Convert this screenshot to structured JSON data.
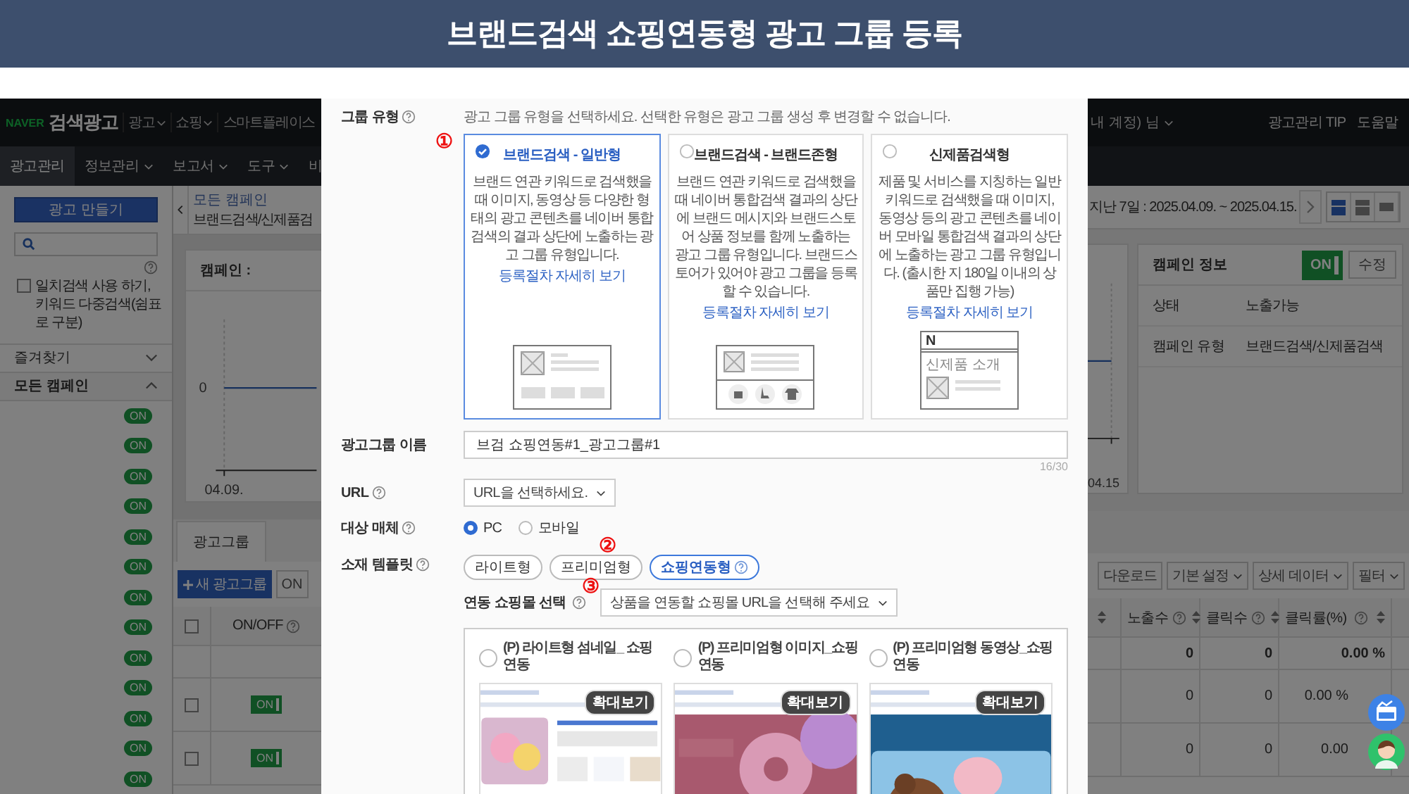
{
  "banner": {
    "title": "브랜드검색 쇼핑연동형 광고 그룹 등록"
  },
  "app": {
    "header": {
      "brand": "NAVER",
      "product": "검색광고",
      "menus": [
        {
          "label": "광고",
          "menu": true
        },
        {
          "label": "쇼핑",
          "menu": true
        },
        {
          "label": "스마트플레이스",
          "menu": false
        }
      ],
      "account": "내 계정) 님",
      "links": [
        "광고관리 TIP",
        "도움말"
      ]
    },
    "nav": [
      {
        "label": "광고관리",
        "selected": true,
        "menu": false
      },
      {
        "label": "정보관리",
        "selected": false,
        "menu": true
      },
      {
        "label": "보고서",
        "selected": false,
        "menu": true
      },
      {
        "label": "도구",
        "selected": false,
        "menu": true
      },
      {
        "label": "비",
        "selected": false,
        "menu": false
      }
    ],
    "sidebar": {
      "create_button": "광고 만들기",
      "exact_match": {
        "lines": [
          "일치검색 사용 하기,",
          "키워드 다중검색(쉼표로 구분)"
        ],
        "checked": false
      },
      "sections": [
        {
          "label": "즐겨찾기",
          "expanded": false
        },
        {
          "label": "모든 캠페인",
          "expanded": true
        }
      ],
      "campaigns": [
        {
          "badge": "ON"
        },
        {
          "badge": "ON"
        },
        {
          "badge": "ON"
        },
        {
          "badge": "ON"
        },
        {
          "badge": "ON"
        },
        {
          "badge": "ON"
        },
        {
          "badge": "ON"
        },
        {
          "badge": "ON"
        },
        {
          "badge": "ON"
        },
        {
          "badge": "ON"
        },
        {
          "badge": "ON"
        },
        {
          "badge": "ON"
        },
        {
          "badge": "ON"
        }
      ]
    },
    "breadcrumb": "모든 캠페인",
    "page_title": "브랜드검색/신제품검",
    "date_range": "지난 7일 : 2025.04.09. ~ 2025.04.15.",
    "views": [
      {
        "selected": true
      },
      {
        "selected": false
      },
      {
        "selected": false
      }
    ],
    "chart": {
      "title": "캠페인 :",
      "y_label": "0",
      "x_labels": [
        "04.09.",
        "04.15"
      ]
    },
    "campaign_info": {
      "title": "캠페인 정보",
      "toggle": {
        "label": "ON",
        "on": true
      },
      "edit": "수정",
      "rows": [
        {
          "key": "상태",
          "value": "노출가능"
        },
        {
          "key": "캠페인 유형",
          "value": "브랜드검색/신제품검색"
        }
      ]
    },
    "tabs": [
      {
        "label": "광고그룹",
        "selected": true
      }
    ],
    "actions": {
      "new_group": "새 광고그룹",
      "on": "ON",
      "tools": [
        {
          "label": "다운로드",
          "menu": false
        },
        {
          "label": "기본 설정",
          "menu": true
        },
        {
          "label": "상세 데이터",
          "menu": true
        },
        {
          "label": "필터",
          "menu": true
        }
      ]
    },
    "table": {
      "columns": [
        "ON/OFF",
        "노출수",
        "클릭수",
        "클릭률(%)"
      ],
      "all_checked": false,
      "summary": [
        "0",
        "0",
        "0.00 %"
      ],
      "rows": [
        {
          "checked": false,
          "toggle": "ON",
          "on": true,
          "cells": [
            "0",
            "0",
            "0.00 %"
          ]
        },
        {
          "checked": false,
          "toggle": "ON",
          "on": true,
          "cells": [
            "0",
            "0",
            "0.00"
          ]
        }
      ]
    }
  },
  "modal": {
    "group_type": {
      "label": "그룹 유형",
      "help": true,
      "hint": "광고 그룹 유형을 선택하세요. 선택한 유형은 광고 그룹 생성 후 변경할 수 없습니다.",
      "marker": "①",
      "options": [
        {
          "title": "브랜드검색 - 일반형",
          "description": "브랜드 연관 키워드로 검색했을 때 이미지, 동영상 등 다양한 형태의 광고 콘텐츠를 네이버 통합검색의 결과 상단에 노출하는 광고 그룹 유형입니다.",
          "link": "등록절차 자세히 보기",
          "selected": true,
          "kind": "general"
        },
        {
          "title": "브랜드검색 - 브랜드존형",
          "description": "브랜드 연관 키워드로 검색했을 때 네이버 통합검색 결과의 상단에 브랜드 메시지와 브랜드스토어 상품 정보를 함께 노출하는 광고 그룹 유형입니다. 브랜드스토어가 있어야 광고 그룹을 등록할 수 있습니다.",
          "link": "등록절차 자세히 보기",
          "selected": false,
          "kind": "store"
        },
        {
          "title": "신제품검색형",
          "description": "제품 및 서비스를 지칭하는 일반 키워드로 검색했을 때 이미지, 동영상 등의 광고 콘텐츠를 네이버 모바일 통합검색 결과의 상단에 노출하는 광고 그룹 유형입니다. (출시한 지 180일 이내의 상품만 집행 가능)",
          "link": "등록절차 자세히 보기",
          "selected": false,
          "kind": "new_product",
          "illustration_texts": [
            "N",
            "신제품 소개"
          ]
        }
      ]
    },
    "name_field": {
      "label": "광고그룹 이름",
      "value": "브검 쇼핑연동#1_광고그룹#1",
      "counter": "16/30"
    },
    "url": {
      "label": "URL",
      "help": true,
      "value": "URL을 선택하세요."
    },
    "media": {
      "label": "대상 매체",
      "help": true,
      "options": [
        {
          "label": "PC",
          "selected": true
        },
        {
          "label": "모바일",
          "selected": false
        }
      ]
    },
    "template": {
      "label": "소재 템플릿",
      "help": true,
      "marker": "②",
      "options": [
        {
          "label": "라이트형",
          "selected": false,
          "help": false
        },
        {
          "label": "프리미엄형",
          "selected": false,
          "help": false
        },
        {
          "label": "쇼핑연동형",
          "selected": true,
          "help": true
        }
      ]
    },
    "shop": {
      "label": "연동 쇼핑몰 선택",
      "help": true,
      "marker": "③",
      "value": "상품을 연동할 쇼핑몰 URL을 선택해 주세요"
    },
    "previews": [
      {
        "label": "(P) 라이트형 섬네일_ 쇼핑연동",
        "selected": false,
        "zoom": "확대보기",
        "kind": "thumbnail"
      },
      {
        "label": "(P) 프리미엄형 이미지_쇼핑연동",
        "selected": false,
        "zoom": "확대보기"
      },
      {
        "label": "(P) 프리미엄형 동영상_쇼핑연동",
        "selected": false,
        "zoom": "확대보기",
        "kind": "video"
      }
    ]
  }
}
